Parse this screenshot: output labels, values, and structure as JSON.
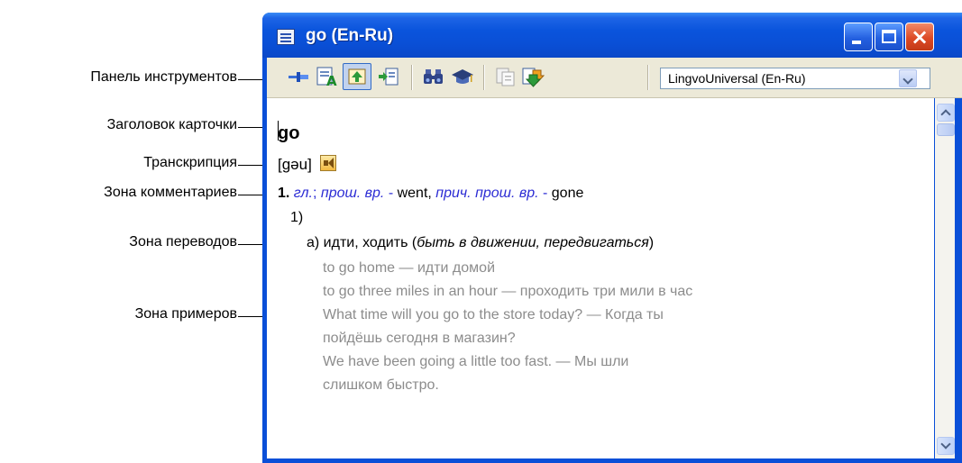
{
  "callouts": {
    "toolbar": "Панель инструментов",
    "card_header": "Заголовок карточки",
    "transcription": "Транскрипция",
    "comments_zone": "Зона комментариев",
    "translations_zone": "Зона переводов",
    "examples_zone": "Зона примеров"
  },
  "window": {
    "title": "go (En-Ru)",
    "controls": {
      "minimize": "minimize",
      "maximize": "maximize",
      "close": "×"
    }
  },
  "toolbar": {
    "icons": [
      "pin-icon",
      "translate-text-icon",
      "up-arrow-page-icon",
      "insert-page-icon",
      "binoculars-icon",
      "graduation-cap-icon",
      "copy-card-icon",
      "green-download-arrows-icon"
    ],
    "dictionary_select": "LingvoUniversal (En-Ru)"
  },
  "card": {
    "headword": "go",
    "transcription": "[gəu]",
    "comment": {
      "num": "1.",
      "pos": "гл.",
      "sep": ";",
      "past_label": "прош. вр.",
      "dash1": "-",
      "past_form": "went,",
      "participle_label": "прич. прош. вр.",
      "dash2": "-",
      "participle_form": "gone"
    },
    "sense_num": "1)",
    "translation": {
      "prefix": "а) идти, ходить (",
      "comment": "быть в движении, передвигаться",
      "suffix": ")"
    },
    "examples": [
      "to go home — идти домой",
      "to go three miles in an hour — проходить три мили в час",
      "What time will you go to the store today? — Когда ты",
      "пойдёшь сегодня в магазин?",
      "We have been going a little too fast. — Мы шли",
      "слишком быстро."
    ]
  },
  "colors": {
    "title_bar": "#0a54dc",
    "grammar_blue": "#2b2bd4",
    "example_gray": "#8c8c8c"
  }
}
